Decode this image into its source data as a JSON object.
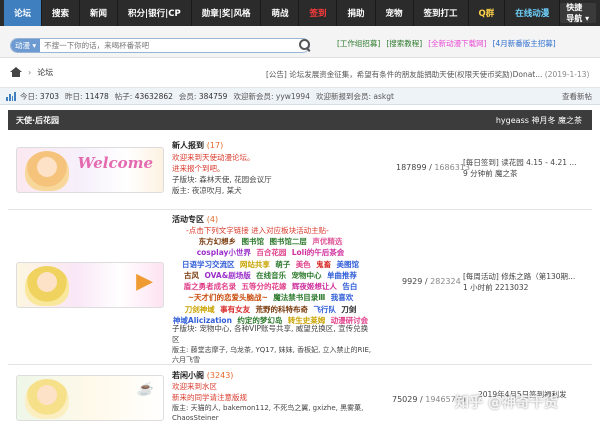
{
  "nav": {
    "items": [
      "论坛",
      "搜索",
      "新闻",
      "积分|银行|CP",
      "勋章|奖|风格",
      "萌战",
      "签到",
      "捐助",
      "宠物",
      "签到打工",
      "Q群",
      "在线动漫"
    ],
    "quick_nav": "快捷导航 ▾"
  },
  "search": {
    "scope": "动漫 ▾",
    "placeholder": "不搜一下你的话，来喝杯番茶吧",
    "links": [
      {
        "label": "[工作组招募]",
        "color": "#2d7a2d"
      },
      {
        "label": "[搜索教程]",
        "color": "#2d7a2d"
      },
      {
        "label": "[全新动漫下载网]",
        "color": "#e94bd6"
      },
      {
        "label": "[4月新番版主招募]",
        "color": "#2f6fcf"
      }
    ]
  },
  "breadcrumb": {
    "separator": "›",
    "forum": "论坛",
    "announcement": "[公告] 论坛发展资金征集，希望有条件的朋友能捐助天使(权限天使币奖励)Donat...",
    "announcement_date": "(2019-1-13)"
  },
  "stats": {
    "today_label": "今日:",
    "today": "3703",
    "yesterday_label": "昨日:",
    "yesterday": "11478",
    "posts_label": "帖子:",
    "posts": "43632862",
    "members_label": "会员:",
    "members": "384759",
    "welcome": "欢迎新会员: yyw1994",
    "latest": "欢迎新报到会员: askgt",
    "new_posts": "查看新帖"
  },
  "section": {
    "title": "天使·后花园",
    "mods": "hygeass  神月冬  魔之茶"
  },
  "forums": [
    {
      "name": "新人报到",
      "today": "(17)",
      "desc": "欢迎来到天使动漫论坛。",
      "desc2": "进来报个到吧。",
      "sub": "子版块: 森林天使, 花园会议厅",
      "mods": "版主: 夜凉吹月, 某犬",
      "banner_text": "Welcome",
      "topics": "187899",
      "posts": "1686313",
      "last1": "[每日签到] 读花园 4.15 - 4.21 ...",
      "last2": "9 分钟前 魔之茶"
    },
    {
      "name": "活动专区",
      "today": "(4)",
      "desc": "-点击下列文字链接 进入对应板块活动主贴-",
      "sub": "子版块: 宠物中心, 各种VIP账号共享, 威望兑换区, 宣传兑换区",
      "mods": "版主: 藤堂志摩子, 乌龙茶, YQ17, 妹妹, 香板妃, 立入禁止的RIE, 六月飞雪",
      "banner_text": "▶",
      "topics": "9929",
      "posts": "282324",
      "last1": "[每周活动] 修炼之路（第130期...",
      "last2": "1 小时前 2213032"
    },
    {
      "name": "若闲小阁",
      "today": "(3243)",
      "desc": "欢迎来到水区",
      "desc2": "新来的同学请注意版规",
      "sub": "版主: 天猫的人, bakemon112, 不死鸟之翼, gxizhe, 黑雾菓, ChaosSteiner",
      "banner_text": "☕",
      "topics": "75029",
      "posts": "19465765",
      "last1": "2019年4月5日签到福利发",
      "last2": "知乎 @神奇干货"
    }
  ],
  "activity_links": [
    {
      "text": "东方幻想乡",
      "color": "#7a3d10"
    },
    {
      "text": "图书馆",
      "color": "#2e7a2e"
    },
    {
      "text": "图书馆二层",
      "color": "#2e7a2e"
    },
    {
      "text": "声优精选",
      "color": "#e05a9a"
    },
    {
      "text": "cosplay小世界",
      "color": "#9b2fc9"
    },
    {
      "text": "百合花园",
      "color": "#e0408a"
    },
    {
      "text": "Loli的午后茶会",
      "color": "#cf2f9d"
    },
    {
      "text": "日语学习交流区",
      "color": "#2f5dd8"
    },
    {
      "text": "网站共享",
      "color": "#c9a400"
    },
    {
      "text": "萌子",
      "color": "#2e7a2e"
    },
    {
      "text": "美色",
      "color": "#e0408a"
    },
    {
      "text": "鬼畜",
      "color": "#d82a2a"
    },
    {
      "text": "美图馆",
      "color": "#2f5dd8"
    },
    {
      "text": "古风",
      "color": "#7a3d10"
    },
    {
      "text": "OVA&剧场版",
      "color": "#9b2fc9"
    },
    {
      "text": "在线音乐",
      "color": "#2e7a2e"
    },
    {
      "text": "宠物中心",
      "color": "#2e7a2e"
    },
    {
      "text": "单曲推荐",
      "color": "#2f5dd8"
    },
    {
      "text": "盾之勇者成名录",
      "color": "#e0408a"
    },
    {
      "text": "五等分的花嫁",
      "color": "#e0408a"
    },
    {
      "text": "辉夜姬想让人",
      "color": "#cf2f9d"
    },
    {
      "text": "告白",
      "color": "#2f5dd8"
    },
    {
      "text": "~天才们的恋爱头脑战~",
      "color": "#c94b0c"
    },
    {
      "text": "魔法禁书目录Ⅲ",
      "color": "#2e7a2e"
    },
    {
      "text": "我喜欢",
      "color": "#2f5dd8"
    },
    {
      "text": "刀剑神域",
      "color": "#c9a400"
    },
    {
      "text": "事有女友",
      "color": "#d82a2a"
    },
    {
      "text": "荒野的科特布奇",
      "color": "#7a3d10"
    },
    {
      "text": "飞行队",
      "color": "#2f5dd8"
    },
    {
      "text": "刀剑",
      "color": "#222222"
    },
    {
      "text": "神域Alicization",
      "color": "#2f5dd8"
    },
    {
      "text": "约定的梦幻岛",
      "color": "#2e7a2e"
    },
    {
      "text": "转生史莱姆",
      "color": "#c9a400"
    },
    {
      "text": "动漫研讨会",
      "color": "#e0408a"
    }
  ],
  "watermark": "知乎 @神奇干货"
}
